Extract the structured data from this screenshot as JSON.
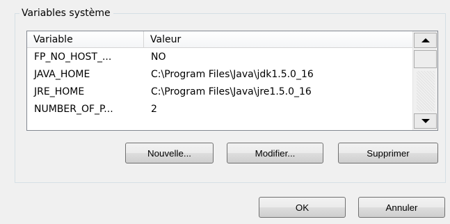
{
  "group": {
    "title": "Variables système"
  },
  "table": {
    "columns": [
      "Variable",
      "Valeur"
    ],
    "rows": [
      {
        "variable": "FP_NO_HOST_...",
        "value": "NO"
      },
      {
        "variable": "JAVA_HOME",
        "value": "C:\\Program Files\\Java\\jdk1.5.0_16"
      },
      {
        "variable": "JRE_HOME",
        "value": "C:\\Program Files\\Java\\jre1.5.0_16"
      },
      {
        "variable": "NUMBER_OF_P...",
        "value": "2"
      }
    ]
  },
  "buttons": {
    "new": "Nouvelle...",
    "edit": "Modifier...",
    "delete": "Supprimer",
    "ok": "OK",
    "cancel": "Annuler"
  },
  "icons": {
    "scroll_up": "arrow-up-icon",
    "scroll_down": "arrow-down-icon"
  }
}
